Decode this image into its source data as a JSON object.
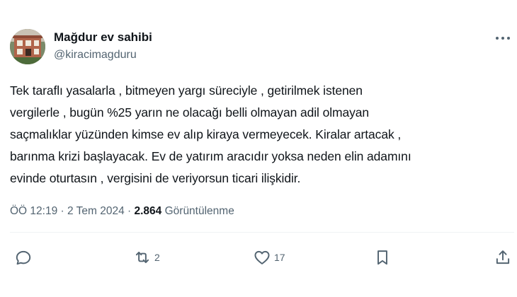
{
  "author": {
    "name": "Mağdur ev sahibi",
    "handle": "@kiracimagduru"
  },
  "tweet": {
    "text": "Tek taraflı yasalarla , bitmeyen yargı süreciyle , getirilmek istenen\nvergilerle , bugün %25 yarın ne olacağı belli olmayan adil olmayan\nsaçmalıklar yüzünden kimse ev alıp kiraya vermeyecek. Kiralar artacak ,\nbarınma krizi başlayacak. Ev de yatırım aracıdır yoksa neden elin adamını\nevinde oturtasın , vergisini de veriyorsun ticari ilişkidir."
  },
  "meta": {
    "time": "ÖÖ 12:19",
    "separator1": " · ",
    "date": "2 Tem 2024",
    "separator2": " · ",
    "views_count": "2.864",
    "views_label": " Görüntülenme"
  },
  "actions": {
    "reply": {
      "icon": "reply-icon",
      "count": ""
    },
    "retweet": {
      "icon": "retweet-icon",
      "count": "2"
    },
    "like": {
      "icon": "heart-icon",
      "count": "17"
    },
    "bookmark": {
      "icon": "bookmark-icon",
      "count": ""
    },
    "share": {
      "icon": "share-icon",
      "count": ""
    }
  },
  "colors": {
    "text_primary": "#0f1419",
    "text_secondary": "#536471",
    "divider": "#eff3f4"
  }
}
